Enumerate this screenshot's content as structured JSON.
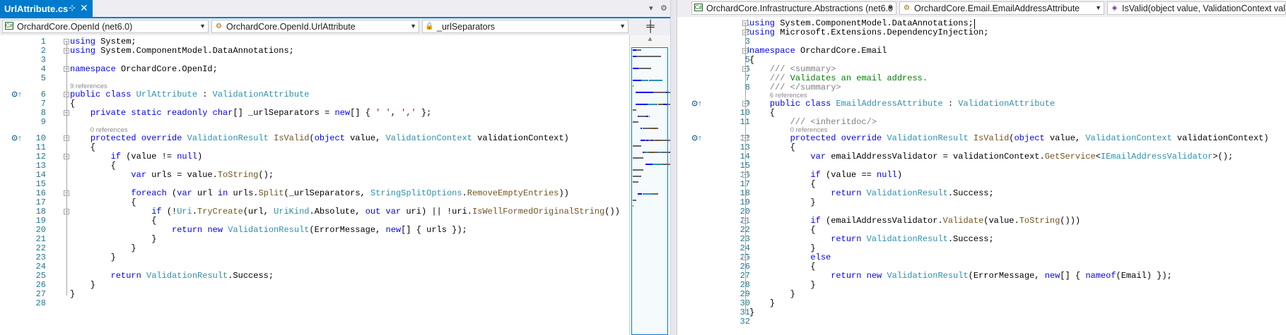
{
  "left": {
    "tab": {
      "title": "UrlAttribute.cs",
      "pin": "⊹",
      "close": "✕"
    },
    "tab_overflow": "▾",
    "tab_settings": "⚙",
    "nav": {
      "project": "OrchardCore.OpenId (net6.0)",
      "type": "OrchardCore.OpenId.UrlAttribute",
      "member": "_urlSeparators"
    },
    "split_button": "╪",
    "lines": [
      {
        "n": "1",
        "t": [
          [
            "kw",
            "using"
          ],
          [
            "tx",
            " System;"
          ]
        ]
      },
      {
        "n": "2",
        "t": [
          [
            "kw",
            "using"
          ],
          [
            "tx",
            " System.ComponentModel.DataAnnotations;"
          ]
        ]
      },
      {
        "n": "3",
        "t": []
      },
      {
        "n": "4",
        "t": [
          [
            "kw",
            "namespace"
          ],
          [
            "tx",
            " OrchardCore.OpenId;"
          ]
        ]
      },
      {
        "n": "5",
        "t": [],
        "refs": "9 references"
      },
      {
        "n": "6",
        "t": [
          [
            "kw",
            "public class "
          ],
          [
            "ty",
            "UrlAttribute"
          ],
          [
            "tx",
            " : "
          ],
          [
            "ty",
            "ValidationAttribute"
          ]
        ],
        "glyph": "⊙↑"
      },
      {
        "n": "7",
        "t": [
          [
            "tx",
            "{"
          ]
        ]
      },
      {
        "n": "8",
        "t": [
          [
            "tx",
            "    "
          ],
          [
            "kw",
            "private static readonly char"
          ],
          [
            "tx",
            "[] _urlSeparators = "
          ],
          [
            "kw",
            "new"
          ],
          [
            "tx",
            "[] { "
          ],
          [
            "st",
            "' '"
          ],
          [
            "tx",
            ", "
          ],
          [
            "st",
            "','"
          ],
          [
            "tx",
            " };"
          ]
        ]
      },
      {
        "n": "9",
        "t": [],
        "refs": "0 references"
      },
      {
        "n": "10",
        "t": [
          [
            "tx",
            "    "
          ],
          [
            "kw",
            "protected override "
          ],
          [
            "ty",
            "ValidationResult"
          ],
          [
            "tx",
            " "
          ],
          [
            "me",
            "IsValid"
          ],
          [
            "tx",
            "("
          ],
          [
            "kw",
            "object"
          ],
          [
            "tx",
            " value, "
          ],
          [
            "ty",
            "ValidationContext"
          ],
          [
            "tx",
            " validationContext)"
          ]
        ],
        "glyph": "⊙↑"
      },
      {
        "n": "11",
        "t": [
          [
            "tx",
            "    {"
          ]
        ]
      },
      {
        "n": "12",
        "t": [
          [
            "tx",
            "        "
          ],
          [
            "kw",
            "if"
          ],
          [
            "tx",
            " (value != "
          ],
          [
            "kw",
            "null"
          ],
          [
            "tx",
            ")"
          ]
        ]
      },
      {
        "n": "13",
        "t": [
          [
            "tx",
            "        {"
          ]
        ]
      },
      {
        "n": "14",
        "t": [
          [
            "tx",
            "            "
          ],
          [
            "kw",
            "var"
          ],
          [
            "tx",
            " urls = value."
          ],
          [
            "me",
            "ToString"
          ],
          [
            "tx",
            "();"
          ]
        ]
      },
      {
        "n": "15",
        "t": []
      },
      {
        "n": "16",
        "t": [
          [
            "tx",
            "            "
          ],
          [
            "kw",
            "foreach"
          ],
          [
            "tx",
            " ("
          ],
          [
            "kw",
            "var"
          ],
          [
            "tx",
            " url "
          ],
          [
            "kw",
            "in"
          ],
          [
            "tx",
            " urls."
          ],
          [
            "me",
            "Split"
          ],
          [
            "tx",
            "(_urlSeparators, "
          ],
          [
            "ty",
            "StringSplitOptions"
          ],
          [
            "tx",
            "."
          ],
          [
            "me",
            "RemoveEmptyEntries"
          ],
          [
            "tx",
            "))"
          ]
        ]
      },
      {
        "n": "17",
        "t": [
          [
            "tx",
            "            {"
          ]
        ]
      },
      {
        "n": "18",
        "t": [
          [
            "tx",
            "                "
          ],
          [
            "kw",
            "if"
          ],
          [
            "tx",
            " (!"
          ],
          [
            "ty",
            "Uri"
          ],
          [
            "tx",
            "."
          ],
          [
            "me",
            "TryCreate"
          ],
          [
            "tx",
            "(url, "
          ],
          [
            "ty",
            "UriKind"
          ],
          [
            "tx",
            ".Absolute, "
          ],
          [
            "kw",
            "out var"
          ],
          [
            "tx",
            " uri) || !uri."
          ],
          [
            "me",
            "IsWellFormedOriginalString"
          ],
          [
            "tx",
            "())"
          ]
        ]
      },
      {
        "n": "19",
        "t": [
          [
            "tx",
            "                {"
          ]
        ]
      },
      {
        "n": "20",
        "t": [
          [
            "tx",
            "                    "
          ],
          [
            "kw",
            "return new "
          ],
          [
            "ty",
            "ValidationResult"
          ],
          [
            "tx",
            "(ErrorMessage, "
          ],
          [
            "kw",
            "new"
          ],
          [
            "tx",
            "[] { urls });"
          ]
        ]
      },
      {
        "n": "21",
        "t": [
          [
            "tx",
            "                }"
          ]
        ]
      },
      {
        "n": "22",
        "t": [
          [
            "tx",
            "            }"
          ]
        ]
      },
      {
        "n": "23",
        "t": [
          [
            "tx",
            "        }"
          ]
        ]
      },
      {
        "n": "24",
        "t": []
      },
      {
        "n": "25",
        "t": [
          [
            "tx",
            "        "
          ],
          [
            "kw",
            "return "
          ],
          [
            "ty",
            "ValidationResult"
          ],
          [
            "tx",
            ".Success;"
          ]
        ]
      },
      {
        "n": "26",
        "t": [
          [
            "tx",
            "    }"
          ]
        ]
      },
      {
        "n": "27",
        "t": [
          [
            "tx",
            "}"
          ]
        ]
      },
      {
        "n": "28",
        "t": []
      }
    ]
  },
  "right": {
    "nav": {
      "project": "OrchardCore.Infrastructure.Abstractions (net6.0",
      "type": "OrchardCore.Email.EmailAddressAttribute",
      "member": "IsValid(object value, ValidationContext validatio"
    },
    "lines": [
      {
        "n": "1",
        "t": [
          [
            "kw",
            "using"
          ],
          [
            "tx",
            " System.ComponentModel.DataAnnotations;"
          ]
        ]
      },
      {
        "n": "2",
        "t": [
          [
            "kw",
            "using"
          ],
          [
            "tx",
            " Microsoft.Extensions.DependencyInjection;"
          ]
        ]
      },
      {
        "n": "3",
        "t": []
      },
      {
        "n": "4",
        "t": [
          [
            "kw",
            "namespace"
          ],
          [
            "tx",
            " OrchardCore.Email"
          ]
        ]
      },
      {
        "n": "5",
        "t": [
          [
            "tx",
            "{"
          ]
        ]
      },
      {
        "n": "6",
        "t": [
          [
            "tx",
            "    "
          ],
          [
            "cmg",
            "/// <summary>"
          ]
        ]
      },
      {
        "n": "7",
        "t": [
          [
            "tx",
            "    "
          ],
          [
            "cmg",
            "///"
          ],
          [
            "cm",
            " Validates an email address."
          ]
        ]
      },
      {
        "n": "8",
        "t": [
          [
            "tx",
            "    "
          ],
          [
            "cmg",
            "/// </summary>"
          ]
        ],
        "refs": "6 references"
      },
      {
        "n": "9",
        "t": [
          [
            "tx",
            "    "
          ],
          [
            "kw",
            "public class "
          ],
          [
            "ty",
            "EmailAddressAttribute"
          ],
          [
            "tx",
            " : "
          ],
          [
            "ty",
            "ValidationAttribute"
          ]
        ],
        "glyph": "⊙↑"
      },
      {
        "n": "10",
        "t": [
          [
            "tx",
            "    {"
          ]
        ]
      },
      {
        "n": "11",
        "t": [
          [
            "tx",
            "        "
          ],
          [
            "cmg",
            "/// <inheritdoc/>"
          ]
        ],
        "refs": "0 references"
      },
      {
        "n": "12",
        "t": [
          [
            "tx",
            "        "
          ],
          [
            "kw",
            "protected override "
          ],
          [
            "ty",
            "ValidationResult"
          ],
          [
            "tx",
            " "
          ],
          [
            "me",
            "IsValid"
          ],
          [
            "tx",
            "("
          ],
          [
            "kw",
            "object"
          ],
          [
            "tx",
            " value, "
          ],
          [
            "ty",
            "ValidationContext"
          ],
          [
            "tx",
            " validationContext)"
          ]
        ],
        "glyph": "⊙↑"
      },
      {
        "n": "13",
        "t": [
          [
            "tx",
            "        {"
          ]
        ]
      },
      {
        "n": "14",
        "t": [
          [
            "tx",
            "            "
          ],
          [
            "kw",
            "var"
          ],
          [
            "tx",
            " emailAddressValidator = validationContext."
          ],
          [
            "me",
            "GetService"
          ],
          [
            "tx",
            "<"
          ],
          [
            "ty",
            "IEmailAddressValidator"
          ],
          [
            "tx",
            ">();"
          ]
        ]
      },
      {
        "n": "15",
        "t": []
      },
      {
        "n": "16",
        "t": [
          [
            "tx",
            "            "
          ],
          [
            "kw",
            "if"
          ],
          [
            "tx",
            " (value == "
          ],
          [
            "kw",
            "null"
          ],
          [
            "tx",
            ")"
          ]
        ]
      },
      {
        "n": "17",
        "t": [
          [
            "tx",
            "            {"
          ]
        ]
      },
      {
        "n": "18",
        "t": [
          [
            "tx",
            "                "
          ],
          [
            "kw",
            "return "
          ],
          [
            "ty",
            "ValidationResult"
          ],
          [
            "tx",
            ".Success;"
          ]
        ]
      },
      {
        "n": "19",
        "t": [
          [
            "tx",
            "            }"
          ]
        ]
      },
      {
        "n": "20",
        "t": []
      },
      {
        "n": "21",
        "t": [
          [
            "tx",
            "            "
          ],
          [
            "kw",
            "if"
          ],
          [
            "tx",
            " (emailAddressValidator."
          ],
          [
            "me",
            "Validate"
          ],
          [
            "tx",
            "(value."
          ],
          [
            "me",
            "ToString"
          ],
          [
            "tx",
            "()))"
          ]
        ]
      },
      {
        "n": "22",
        "t": [
          [
            "tx",
            "            {"
          ]
        ]
      },
      {
        "n": "23",
        "t": [
          [
            "tx",
            "                "
          ],
          [
            "kw",
            "return "
          ],
          [
            "ty",
            "ValidationResult"
          ],
          [
            "tx",
            ".Success;"
          ]
        ]
      },
      {
        "n": "24",
        "t": [
          [
            "tx",
            "            }"
          ]
        ]
      },
      {
        "n": "25",
        "t": [
          [
            "tx",
            "            "
          ],
          [
            "kw",
            "else"
          ]
        ]
      },
      {
        "n": "26",
        "t": [
          [
            "tx",
            "            {"
          ]
        ]
      },
      {
        "n": "27",
        "t": [
          [
            "tx",
            "                "
          ],
          [
            "kw",
            "return new "
          ],
          [
            "ty",
            "ValidationResult"
          ],
          [
            "tx",
            "(ErrorMessage, "
          ],
          [
            "kw",
            "new"
          ],
          [
            "tx",
            "[] { "
          ],
          [
            "kw",
            "nameof"
          ],
          [
            "tx",
            "(Email) });"
          ]
        ]
      },
      {
        "n": "28",
        "t": [
          [
            "tx",
            "            }"
          ]
        ]
      },
      {
        "n": "29",
        "t": [
          [
            "tx",
            "        }"
          ]
        ]
      },
      {
        "n": "30",
        "t": [
          [
            "tx",
            "    }"
          ]
        ]
      },
      {
        "n": "31",
        "t": [
          [
            "tx",
            "}"
          ]
        ]
      },
      {
        "n": "32",
        "t": []
      }
    ]
  },
  "colors": {
    "accent": "#007acc",
    "keyword": "#0000ff",
    "type": "#2b91af",
    "method": "#74531f",
    "string": "#a31515",
    "comment": "#008000",
    "line_number": "#237893"
  }
}
